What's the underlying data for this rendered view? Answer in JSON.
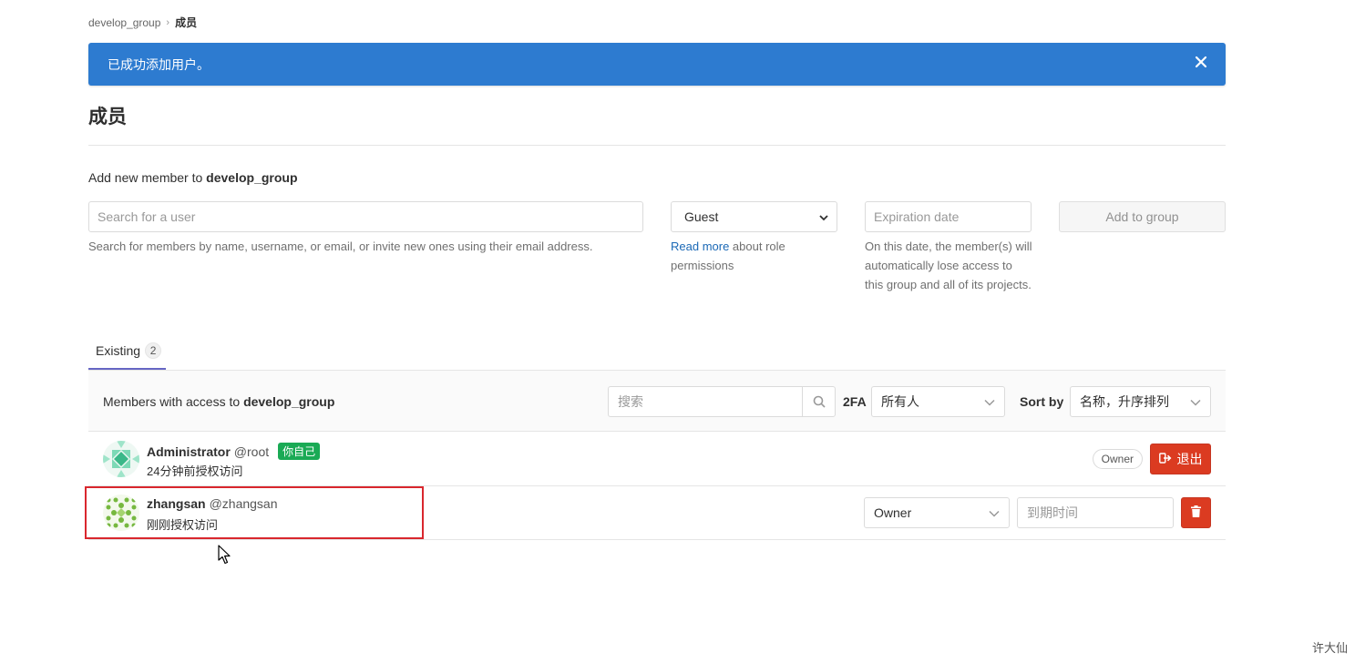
{
  "breadcrumb": {
    "group": "develop_group",
    "current": "成员"
  },
  "flash": {
    "message": "已成功添加用户。"
  },
  "page": {
    "title": "成员"
  },
  "add_member": {
    "label_prefix": "Add new member to ",
    "group_name": "develop_group",
    "search_placeholder": "Search for a user",
    "search_help": "Search for members by name, username, or email, or invite new ones using their email address.",
    "role_value": "Guest",
    "role_help_link": "Read more",
    "role_help_text": " about role permissions",
    "expiration_placeholder": "Expiration date",
    "expiration_help": "On this date, the member(s) will automatically lose access to this group and all of its projects.",
    "add_button": "Add to group"
  },
  "tabs": {
    "existing_label": "Existing",
    "existing_count": "2"
  },
  "members_panel": {
    "title_prefix": "Members with access to ",
    "group_name": "develop_group",
    "search_placeholder": "搜索",
    "twofa_label": "2FA",
    "twofa_value": "所有人",
    "sort_label": "Sort by",
    "sort_value": "名称，升序排列"
  },
  "members": [
    {
      "name": "Administrator",
      "username": "@root",
      "badge": "你自己",
      "granted": "24分钟前授权访问",
      "role_pill": "Owner",
      "leave_label": "退出"
    },
    {
      "name": "zhangsan",
      "username": "@zhangsan",
      "granted": "刚刚授权访问",
      "role_value": "Owner",
      "expiration_placeholder": "到期时间"
    }
  ],
  "watermark": "许大仙",
  "colors": {
    "flash": "#2d7bd0",
    "danger": "#db3b21",
    "success": "#1aaa55",
    "tab_active": "#6666c4",
    "highlight": "#d9272e"
  }
}
